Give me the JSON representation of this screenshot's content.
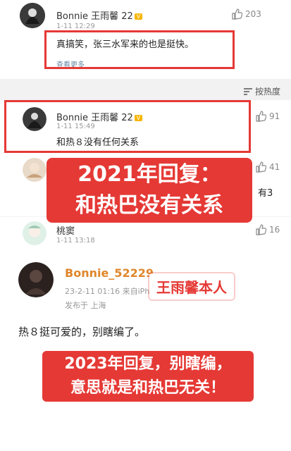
{
  "comment1": {
    "username": "Bonnie 王雨馨 22",
    "badge": "V",
    "time": "1-11 12:29",
    "text": "真搞笑，张三水军来的也是挺快。",
    "extra": "查看更多",
    "likes": "203"
  },
  "sort_label": "按热度",
  "comment2": {
    "username": "Bonnie 王雨馨 22",
    "badge": "V",
    "time": "1-11 15:49",
    "text": "和热８没有任何关系",
    "likes": "91"
  },
  "comment3": {
    "likes": "41",
    "partial": "有3"
  },
  "comment4": {
    "username": "桃窦",
    "time": "1-11 13:18",
    "likes": "16"
  },
  "banner2021": {
    "line1": "2021年回复：",
    "line2": "和热巴没有关系"
  },
  "post2023": {
    "username": "Bonnie_52229",
    "time": "23-2-11 01:16  来自iPhone客户端",
    "location": "发布于 上海",
    "text": "热８挺可爱的，别瞎编了。",
    "tag": "王雨馨本人"
  },
  "banner2023": {
    "line1": "2023年回复，别瞎编，",
    "line2": "意思就是和热巴无关！"
  },
  "colors": {
    "red": "#e53935",
    "badge": "#f7b500"
  }
}
